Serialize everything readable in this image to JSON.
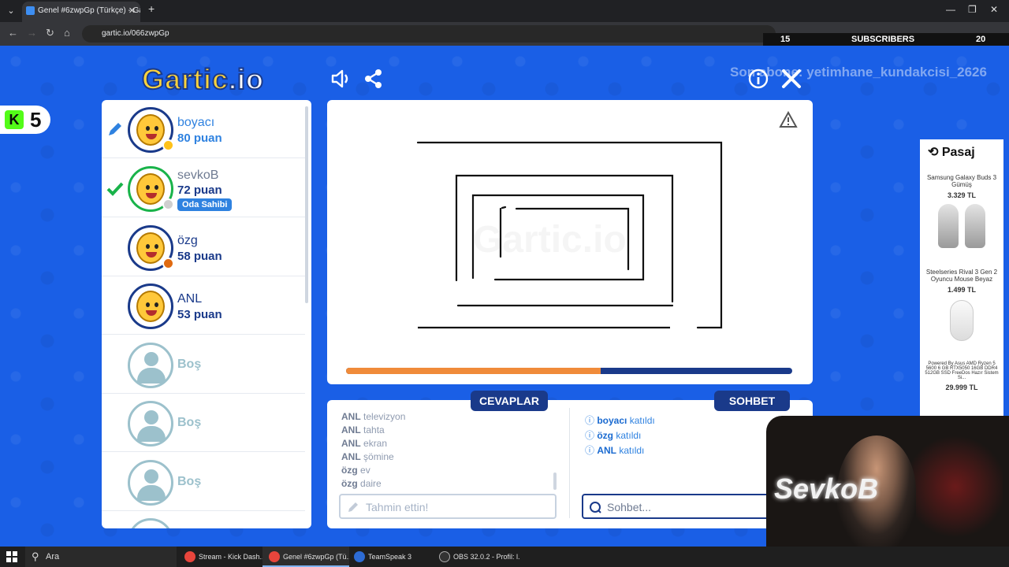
{
  "browser": {
    "tab_title": "Genel #6zwpGp (Türkçe) - Gartic",
    "url": "gartic.io/066zwpGp",
    "new_tab": "+",
    "tab_close": "✕"
  },
  "overlay": {
    "subs_left": "15",
    "subs_label": "SUBSCRIBERS",
    "subs_right": "20",
    "kick_count": "5",
    "kick_letter": "K"
  },
  "header": {
    "logo_main": "Gartic",
    "logo_suffix": ".io",
    "room_text": "Son abone: yetimhane_kundakcisi_2626"
  },
  "players": [
    {
      "name": "boyacı",
      "score": "80 puan",
      "dot_color": "#ffc21a",
      "status": "drawing"
    },
    {
      "name": "sevkoB",
      "score": "72 puan",
      "dot_color": "#cfcfcf",
      "status": "guessed",
      "badge": "Oda Sahibi"
    },
    {
      "name": "özg",
      "score": "58 puan",
      "dot_color": "#e06a10",
      "status": ""
    },
    {
      "name": "ANL",
      "score": "53 puan",
      "dot_color": "",
      "status": ""
    }
  ],
  "empty_slots": [
    "Boş",
    "Boş",
    "Boş"
  ],
  "canvas": {
    "watermark": "Gartic.io",
    "progress": 0.57,
    "colors": {
      "progress_fill": "#f08b3a",
      "progress_track": "#1a3a8a"
    }
  },
  "answers_tab": "CEVAPLAR",
  "chat_tab": "SOHBET",
  "answers": [
    {
      "user": "ANL",
      "text": "televizyon"
    },
    {
      "user": "ANL",
      "text": "tahta"
    },
    {
      "user": "ANL",
      "text": "ekran"
    },
    {
      "user": "ANL",
      "text": "şömine"
    },
    {
      "user": "özg",
      "text": "ev"
    },
    {
      "user": "özg",
      "text": "daire"
    }
  ],
  "guess_placeholder": "Tahmin ettin!",
  "chat": [
    {
      "user": "boyacı",
      "text": "katıldı"
    },
    {
      "user": "özg",
      "text": "katıldı"
    },
    {
      "user": "ANL",
      "text": "katıldı"
    }
  ],
  "chat_placeholder": "Sohbet...",
  "ad": {
    "brand": "Pasaj",
    "items": [
      {
        "name": "Samsung Galaxy Buds 3 Gümüş",
        "price": "3.329 TL"
      },
      {
        "name": "Steelseries Rival 3 Gen 2 Oyuncu Mouse Beyaz",
        "price": "1.499 TL"
      },
      {
        "name": "Powered By Asus AMD Ryzen 5 5600 6 GB RTX5050 16GB DDR4 512GB SSD FreeDos Hazır Sistem Si...",
        "price": "29.999 TL"
      }
    ]
  },
  "webcam": {
    "name": "SevkoB"
  },
  "taskbar": {
    "search": "Ara",
    "items": [
      {
        "label": "Stream - Kick Dash...",
        "color": "#e8453c"
      },
      {
        "label": "Genel #6zwpGp (Tü...",
        "color": "#e8453c"
      },
      {
        "label": "TeamSpeak 3",
        "color": "#2d6bd4"
      },
      {
        "label": "OBS 32.0.2 - Profil: l...",
        "color": "#333333"
      }
    ]
  }
}
